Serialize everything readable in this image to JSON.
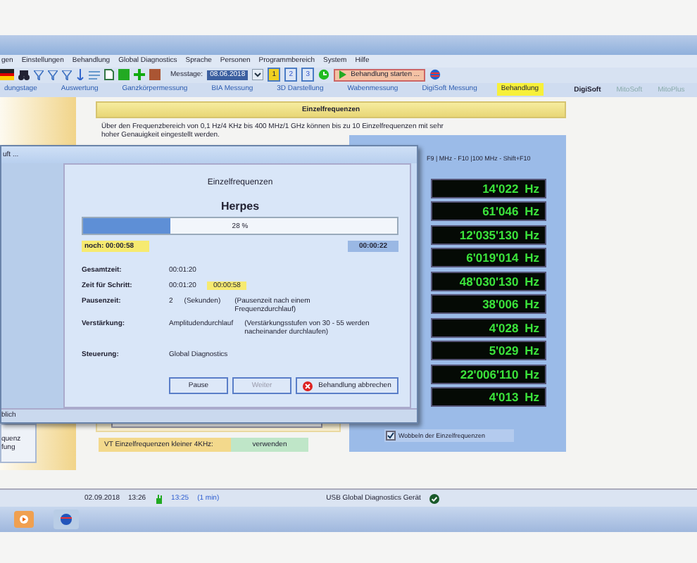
{
  "menu": [
    "gen",
    "Einstellungen",
    "Behandlung",
    "Global Diagnostics",
    "Sprache",
    "Personen",
    "Programmbereich",
    "System",
    "Hilfe"
  ],
  "toolbar": {
    "date_label": "Messtage:",
    "date": "08.06.2018",
    "pages": [
      {
        "label": "1",
        "selected": true
      },
      {
        "label": "2",
        "selected": false
      },
      {
        "label": "3",
        "selected": false
      }
    ],
    "start_button": "Behandlung starten ..."
  },
  "tabs": [
    {
      "label": "dungstage",
      "selected": false
    },
    {
      "label": "Auswertung",
      "selected": false
    },
    {
      "label": "Ganzkörpermessung",
      "selected": false
    },
    {
      "label": "BIA Messung",
      "selected": false
    },
    {
      "label": "3D Darstellung",
      "selected": false
    },
    {
      "label": "Wabenmessung",
      "selected": false
    },
    {
      "label": "DigiSoft Messung",
      "selected": false
    },
    {
      "label": "Behandlung",
      "selected": true
    }
  ],
  "modules": [
    {
      "label": "DigiSoft",
      "selected": true
    },
    {
      "label": "MitoSoft",
      "selected": false
    },
    {
      "label": "MitoPlus",
      "selected": false
    }
  ],
  "left_panel": {
    "lines": [
      "quenz",
      "fung"
    ]
  },
  "panel": {
    "title": "Einzelfrequenzen",
    "description": "Über den Frequenzbereich von 0,1 Hz/4 KHz bis 400 MHz/1 GHz können bis zu 10 Einzelfrequenzen mit sehr hoher Genauigkeit eingestellt werden.",
    "shortcut_hint": "F9 | MHz - F10 |100 MHz - Shift+F10",
    "frequencies": [
      "14'022 Hz",
      "61'046 Hz",
      "12'035'130 Hz",
      "6'019'014 Hz",
      "48'030'130 Hz",
      "38'006 Hz",
      "4'028 Hz",
      "5'029 Hz",
      "22'006'110 Hz",
      "4'013 Hz"
    ],
    "sweep": {
      "label": "Wobbeln der Einzelfrequenzen",
      "checked": true
    },
    "vt_label": "VT Einzelfrequenzen kleiner 4KHz:",
    "vt_value": "verwenden"
  },
  "dialog": {
    "title": "uft ...",
    "heading": "Einzelfrequenzen",
    "program": "Herpes",
    "progress": {
      "level": 0.28,
      "label": "28 %"
    },
    "remaining": "noch: 00:00:58",
    "elapsed": "00:00:22",
    "rows": [
      {
        "label": "Gesamtzeit:",
        "value": "00:01:20"
      },
      {
        "label": "Zeit für Schritt:",
        "value": "00:01:20",
        "highlight": "00:00:58"
      },
      {
        "label": "Pausenzeit:",
        "value": "2",
        "unit": "(Sekunden)",
        "note": "(Pausenzeit nach einem Frequenzdurchlauf)"
      },
      {
        "label": "Verstärkung:",
        "value": "Amplitudendurchlauf",
        "note": "(Verstärkungsstufen von 30 - 55 werden nacheinander durchlaufen)"
      },
      {
        "label": "Steuerung:",
        "value": "Global Diagnostics"
      }
    ],
    "buttons": [
      {
        "label": "Pause",
        "kind": "plain",
        "disabled": false
      },
      {
        "label": "Weiter",
        "kind": "plain",
        "disabled": true
      },
      {
        "label": "Behandlung abbrechen",
        "kind": "cancel",
        "disabled": false
      }
    ],
    "footer": "blich"
  },
  "status_bar": {
    "date": "02.09.2018",
    "time": "13:26",
    "start": "13:25",
    "duration": "(1 min)",
    "device": "USB Global Diagnostics Gerät",
    "device_ok": true
  }
}
